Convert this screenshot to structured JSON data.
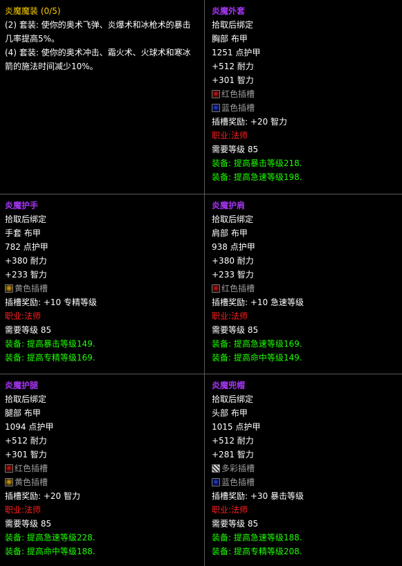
{
  "set": {
    "name": "炎魔魔装",
    "count": "(0/5)",
    "bonus_2": "(2) 套装: 使你的奥术飞弹、炎爆术和冰枪术的暴击几率提高5%。",
    "bonus_4": "(4) 套装: 使你的奥术冲击、霜火术、火球术和寒冰箭的施法时间减少10%。"
  },
  "items": [
    {
      "name": "炎魔外套",
      "bind": "拾取后绑定",
      "slot": "胸部 布甲",
      "armor": "1251 点护甲",
      "stam": "+512 耐力",
      "intel": "+301 智力",
      "sockets": [
        {
          "color": "red",
          "label": "红色插槽"
        },
        {
          "color": "blue",
          "label": "蓝色插槽"
        }
      ],
      "socket_bonus": "插槽奖励: +20 智力",
      "class_label": "职业: ",
      "class_value": "法师",
      "req_level": "需要等级 85",
      "equip": [
        "装备: 提高暴击等级218.",
        "装备: 提高急速等级198."
      ]
    },
    {
      "name": "炎魔护手",
      "bind": "拾取后绑定",
      "slot": "手套 布甲",
      "armor": "782 点护甲",
      "stam": "+380 耐力",
      "intel": "+233 智力",
      "sockets": [
        {
          "color": "yellow",
          "label": "黄色插槽"
        }
      ],
      "socket_bonus": "插槽奖励: +10 专精等级",
      "class_label": "职业: ",
      "class_value": "法师",
      "req_level": "需要等级 85",
      "equip": [
        "装备: 提高暴击等级149.",
        "装备: 提高专精等级169."
      ]
    },
    {
      "name": "炎魔护肩",
      "bind": "拾取后绑定",
      "slot": "肩部 布甲",
      "armor": "938 点护甲",
      "stam": "+380 耐力",
      "intel": "+233 智力",
      "sockets": [
        {
          "color": "red",
          "label": "红色插槽"
        }
      ],
      "socket_bonus": "插槽奖励: +10 急速等级",
      "class_label": "职业: ",
      "class_value": "法师",
      "req_level": "需要等级 85",
      "equip": [
        "装备: 提高急速等级169.",
        "装备: 提高命中等级149."
      ]
    },
    {
      "name": "炎魔护腿",
      "bind": "拾取后绑定",
      "slot": "腿部 布甲",
      "armor": "1094 点护甲",
      "stam": "+512 耐力",
      "intel": "+301 智力",
      "sockets": [
        {
          "color": "red",
          "label": "红色插槽"
        },
        {
          "color": "yellow",
          "label": "黄色插槽"
        }
      ],
      "socket_bonus": "插槽奖励: +20 智力",
      "class_label": "职业: ",
      "class_value": "法师",
      "req_level": "需要等级 85",
      "equip": [
        "装备: 提高急速等级228.",
        "装备: 提高命中等级188."
      ]
    },
    {
      "name": "炎魔兜帽",
      "bind": "拾取后绑定",
      "slot": "头部 布甲",
      "armor": "1015 点护甲",
      "stam": "+512 耐力",
      "intel": "+281 智力",
      "sockets": [
        {
          "color": "prismatic",
          "label": "多彩插槽"
        },
        {
          "color": "blue",
          "label": "蓝色插槽"
        }
      ],
      "socket_bonus": "插槽奖励: +30 暴击等级",
      "class_label": "职业: ",
      "class_value": "法师",
      "req_level": "需要等级 85",
      "equip": [
        "装备: 提高急速等级188.",
        "装备: 提高专精等级208."
      ]
    }
  ],
  "colors": {
    "epic": "#a335ee",
    "set": "#ffd100",
    "class_red": "#ff2020",
    "equip_green": "#1eff00",
    "socket_gray": "#9d9d9d"
  }
}
